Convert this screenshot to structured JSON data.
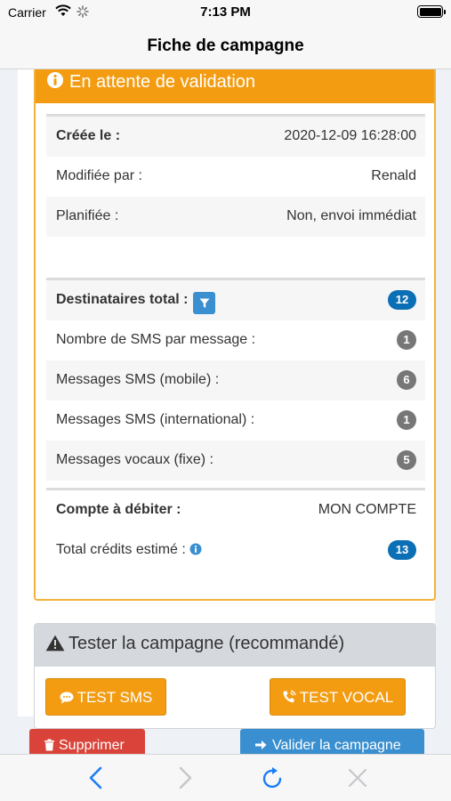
{
  "status_bar": {
    "carrier": "Carrier",
    "time": "7:13 PM"
  },
  "nav": {
    "title": "Fiche de campagne"
  },
  "card": {
    "header": "En attente de validation",
    "rows": [
      {
        "label": "Créée le :",
        "value": "2020-12-09 16:28:00"
      },
      {
        "label": "Modifiée par :",
        "value": "Renald"
      },
      {
        "label": "Planifiée :",
        "value": "Non, envoi immédiat"
      },
      {
        "label": "Destinataires total :",
        "badge": "12"
      },
      {
        "label": "Nombre de SMS par message :",
        "badge": "1"
      },
      {
        "label": "Messages SMS (mobile) :",
        "badge": "6"
      },
      {
        "label": "Messages SMS (international) :",
        "badge": "1"
      },
      {
        "label": "Messages vocaux (fixe) :",
        "badge": "5"
      },
      {
        "label": "Compte à débiter :",
        "value": "MON COMPTE"
      },
      {
        "label": "Total crédits estimé :",
        "badge": "13"
      }
    ]
  },
  "test": {
    "header": "Tester la campagne (recommandé)",
    "sms_button": "TEST SMS",
    "vocal_button": "TEST VOCAL"
  },
  "actions": {
    "delete": "Supprimer",
    "validate": "Valider la campagne"
  },
  "colors": {
    "header_orange": "#f39c12",
    "badge_blue": "#0b6fb6",
    "badge_grey": "#777777",
    "danger": "#d9433a",
    "primary": "#3a8fd0",
    "ios_blue": "#1a7cf5"
  },
  "toolbar": {
    "icons": [
      "chevron-left-icon",
      "chevron-right-icon",
      "reload-icon",
      "close-icon"
    ]
  }
}
